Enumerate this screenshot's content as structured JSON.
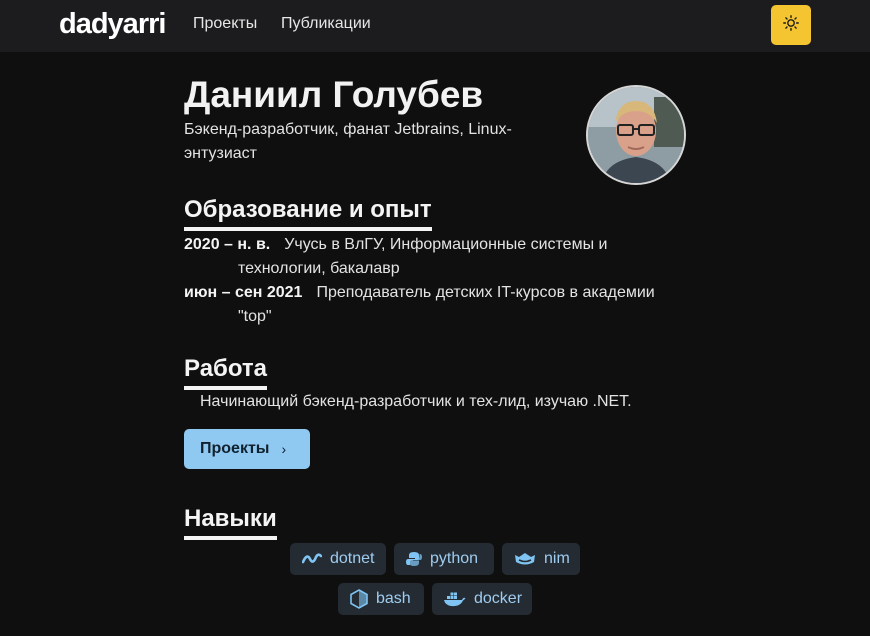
{
  "nav": {
    "brand": "dadyarri",
    "links": [
      "Проекты",
      "Публикации"
    ]
  },
  "profile": {
    "name": "Даниил Голубев",
    "subtitle": "Бэкенд-разработчик, фанат Jetbrains, Linux-энтузиаст"
  },
  "education": {
    "title": "Образование и опыт",
    "items": [
      {
        "date": "2020 – н. в.",
        "line1": "Учусь в ВлГУ, Информационные системы и",
        "line2": "технологии, бакалавр"
      },
      {
        "date": "июн – сен 2021",
        "line1": "Преподаватель детских IT-курсов в академии",
        "line2": "\"top\""
      }
    ]
  },
  "work": {
    "title": "Работа",
    "text": "Начинающий бэкенд-разработчик и тех-лид, изучаю .NET.",
    "button_label": "Проекты"
  },
  "skills": {
    "title": "Навыки",
    "tags": [
      {
        "label": "dotnet",
        "icon": "dotnet-icon"
      },
      {
        "label": "python",
        "icon": "python-icon"
      },
      {
        "label": "nim",
        "icon": "nim-icon"
      },
      {
        "label": "bash",
        "icon": "bash-icon"
      },
      {
        "label": "docker",
        "icon": "docker-icon"
      }
    ]
  },
  "colors": {
    "accent": "#f5c531",
    "button": "#8fc8f0",
    "tag_bg": "#252b32",
    "tag_text": "#9ecdf0"
  }
}
